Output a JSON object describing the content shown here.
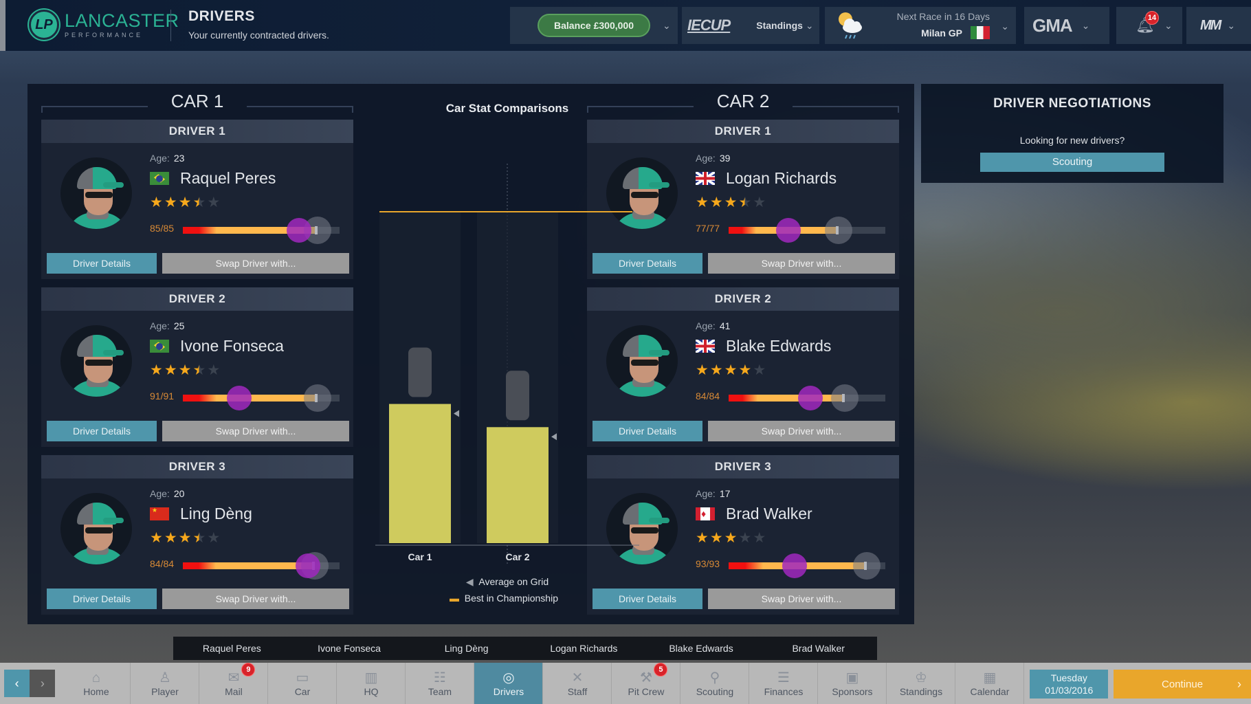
{
  "header": {
    "brand": "LANCASTER",
    "brand_sub": "PERFORMANCE",
    "logo_initials": "LP",
    "title": "DRIVERS",
    "subtitle": "Your currently contracted drivers.",
    "balance": "Balance  £300,000",
    "series_logo": "IECUP",
    "standings": "Standings",
    "weather_icon": "sun-cloud-rain-icon",
    "next_race_label": "Next Race in 16 Days",
    "next_race_name": "Milan GP",
    "gma": "GMA",
    "notifications": "14",
    "mm": "MM"
  },
  "cars": [
    {
      "title": "CAR 1",
      "drivers": [
        {
          "slot": "DRIVER 1",
          "age_label": "Age:",
          "age": "23",
          "name": "Raquel Peres",
          "nationality": "brazil",
          "stars": 3.5,
          "fitness": "85/85",
          "fitness_pct": 100,
          "morale_pct": 74,
          "potential_pct": 86,
          "details": "Driver Details",
          "swap": "Swap Driver with..."
        },
        {
          "slot": "DRIVER 2",
          "age_label": "Age:",
          "age": "25",
          "name": "Ivone Fonseca",
          "nationality": "brazil",
          "stars": 3.5,
          "fitness": "91/91",
          "fitness_pct": 100,
          "morale_pct": 36,
          "potential_pct": 86,
          "details": "Driver Details",
          "swap": "Swap Driver with..."
        },
        {
          "slot": "DRIVER 3",
          "age_label": "Age:",
          "age": "20",
          "name": "Ling Dèng",
          "nationality": "china",
          "stars": 3.5,
          "fitness": "84/84",
          "fitness_pct": 100,
          "morale_pct": 80,
          "potential_pct": 84,
          "details": "Driver Details",
          "swap": "Swap Driver with..."
        }
      ]
    },
    {
      "title": "CAR 2",
      "drivers": [
        {
          "slot": "DRIVER 1",
          "age_label": "Age:",
          "age": "39",
          "name": "Logan Richards",
          "nationality": "uk",
          "stars": 3.5,
          "fitness": "77/77",
          "fitness_pct": 100,
          "morale_pct": 38,
          "potential_pct": 70,
          "details": "Driver Details",
          "swap": "Swap Driver with..."
        },
        {
          "slot": "DRIVER 2",
          "age_label": "Age:",
          "age": "41",
          "name": "Blake Edwards",
          "nationality": "uk",
          "stars": 4,
          "fitness": "84/84",
          "fitness_pct": 100,
          "morale_pct": 52,
          "potential_pct": 74,
          "details": "Driver Details",
          "swap": "Swap Driver with..."
        },
        {
          "slot": "DRIVER 3",
          "age_label": "Age:",
          "age": "17",
          "name": "Brad Walker",
          "nationality": "canada",
          "stars": 3,
          "fitness": "93/93",
          "fitness_pct": 100,
          "morale_pct": 42,
          "potential_pct": 88,
          "details": "Driver Details",
          "swap": "Swap Driver with..."
        }
      ]
    }
  ],
  "chart_data": {
    "type": "bar",
    "title": "Car Stat Comparisons",
    "categories": [
      "Car 1",
      "Car 2"
    ],
    "values": [
      42,
      35
    ],
    "average_on_grid": [
      39,
      32
    ],
    "best_in_championship": 100,
    "ylim": [
      0,
      100
    ],
    "legend": [
      {
        "marker": "triangle-left",
        "label": "Average on Grid"
      },
      {
        "marker": "dash",
        "label": "Best in Championship"
      }
    ],
    "colors": {
      "bar": "#cfcb5e",
      "best": "#e9a62b",
      "avg": "#9aa0a8"
    }
  },
  "negotiations": {
    "title": "DRIVER NEGOTIATIONS",
    "question": "Looking for new drivers?",
    "button": "Scouting"
  },
  "driver_strip": [
    "Raquel Peres",
    "Ivone Fonseca",
    "Ling Dèng",
    "Logan Richards",
    "Blake Edwards",
    "Brad Walker"
  ],
  "nav": {
    "items": [
      {
        "label": "Home",
        "icon": "⌂"
      },
      {
        "label": "Player",
        "icon": "♙"
      },
      {
        "label": "Mail",
        "icon": "✉",
        "badge": "9"
      },
      {
        "label": "Car",
        "icon": "▭"
      },
      {
        "label": "HQ",
        "icon": "▥"
      },
      {
        "label": "Team",
        "icon": "☷"
      },
      {
        "label": "Drivers",
        "icon": "◎",
        "active": true
      },
      {
        "label": "Staff",
        "icon": "✕"
      },
      {
        "label": "Pit Crew",
        "icon": "⚒",
        "badge": "5"
      },
      {
        "label": "Scouting",
        "icon": "⚲"
      },
      {
        "label": "Finances",
        "icon": "☰"
      },
      {
        "label": "Sponsors",
        "icon": "▣"
      },
      {
        "label": "Standings",
        "icon": "♔"
      },
      {
        "label": "Calendar",
        "icon": "▦"
      }
    ],
    "date_day": "Tuesday",
    "date": "01/03/2016",
    "continue": "Continue"
  }
}
